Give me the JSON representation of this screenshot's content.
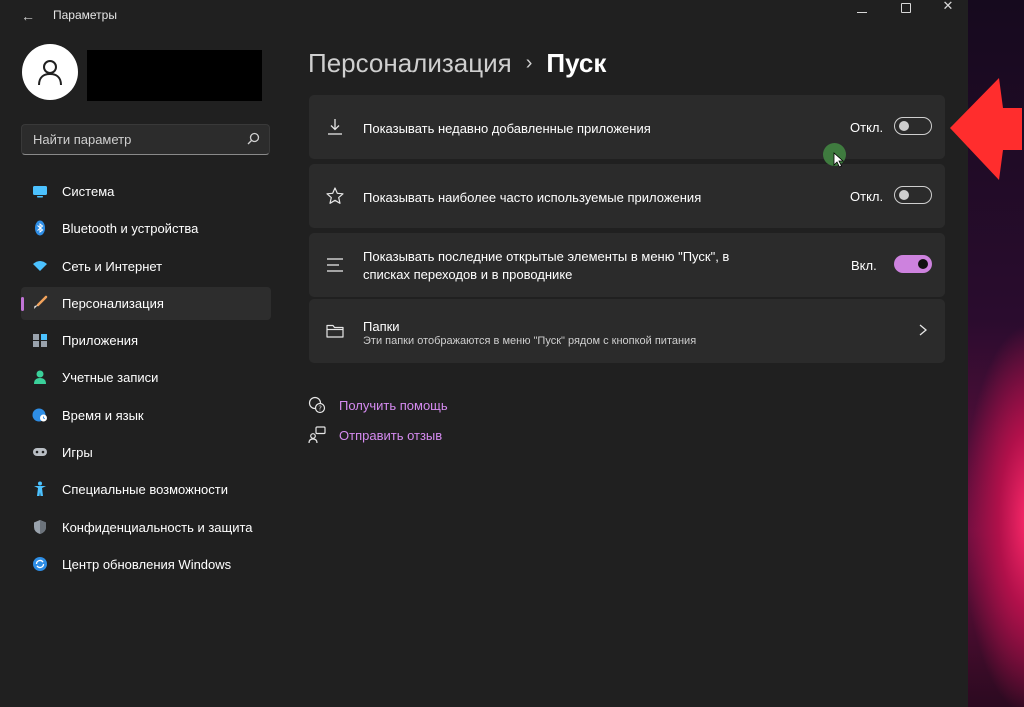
{
  "window": {
    "title": "Параметры",
    "back_icon": "back-arrow-icon",
    "controls": [
      "minimize-icon",
      "maximize-icon",
      "close-icon"
    ]
  },
  "search": {
    "placeholder": "Найти параметр",
    "value": "",
    "icon": "search-icon"
  },
  "sidebar": {
    "items": [
      {
        "label": "Система",
        "icon": "monitor-icon",
        "active": false
      },
      {
        "label": "Bluetooth и устройства",
        "icon": "bluetooth-icon",
        "active": false
      },
      {
        "label": "Сеть и Интернет",
        "icon": "wifi-icon",
        "active": false
      },
      {
        "label": "Персонализация",
        "icon": "brush-icon",
        "active": true
      },
      {
        "label": "Приложения",
        "icon": "apps-icon",
        "active": false
      },
      {
        "label": "Учетные записи",
        "icon": "person-icon",
        "active": false
      },
      {
        "label": "Время и язык",
        "icon": "globe-clock-icon",
        "active": false
      },
      {
        "label": "Игры",
        "icon": "gamepad-icon",
        "active": false
      },
      {
        "label": "Специальные возможности",
        "icon": "accessibility-icon",
        "active": false
      },
      {
        "label": "Конфиденциальность и защита",
        "icon": "shield-icon",
        "active": false
      },
      {
        "label": "Центр обновления Windows",
        "icon": "update-icon",
        "active": false
      }
    ]
  },
  "breadcrumb": {
    "parent": "Персонализация",
    "separator": "›",
    "current": "Пуск"
  },
  "settings": [
    {
      "label": "Показывать недавно добавленные приложения",
      "state_text": "Откл.",
      "on": false,
      "icon": "download-icon"
    },
    {
      "label": "Показывать наиболее часто используемые приложения",
      "state_text": "Откл.",
      "on": false,
      "icon": "star-icon"
    },
    {
      "label_line1": "Показывать последние открытые элементы в меню \"Пуск\", в",
      "label_line2": "списках переходов и в проводнике",
      "state_text": "Вкл.",
      "on": true,
      "icon": "list-icon"
    },
    {
      "label": "Папки",
      "sublabel": "Эти папки отображаются в меню \"Пуск\" рядом с кнопкой питания",
      "icon": "folder-icon",
      "chevron": "chevron-right-icon"
    }
  ],
  "links": [
    {
      "label": "Получить помощь",
      "icon": "help-icon"
    },
    {
      "label": "Отправить отзыв",
      "icon": "feedback-icon"
    }
  ],
  "colors": {
    "accent": "#cd82de",
    "link": "#d58bf0",
    "window_bg": "#202020",
    "card_bg": "#2b2b2b",
    "annotation_arrow": "#ff2d2d",
    "cursor_highlight": "#3f7b3f"
  }
}
